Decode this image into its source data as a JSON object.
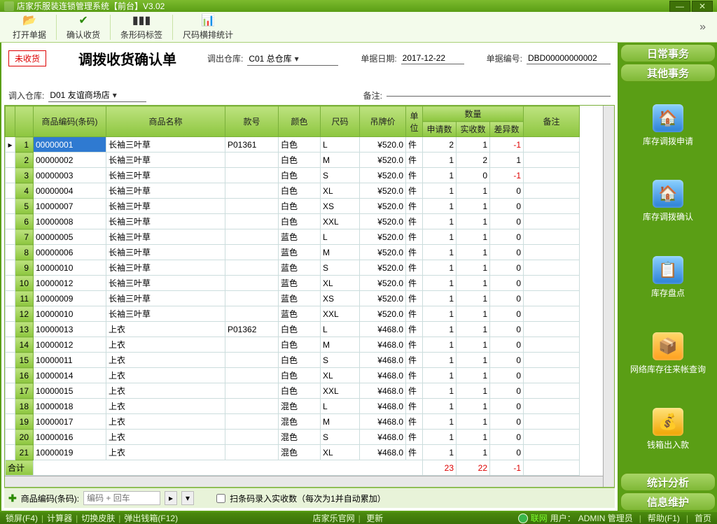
{
  "title": "店家乐服装连锁管理系统【前台】V3.02",
  "toolbar": {
    "open": "打开单据",
    "confirm": "确认收货",
    "barcode": "条形码标签",
    "sizerpt": "尺码横排统计"
  },
  "badge": "未收货",
  "form_title": "调拨收货确认单",
  "out_wh_lbl": "调出仓库:",
  "out_wh": "C01 总仓库",
  "date_lbl": "单据日期:",
  "date": "2017-12-22",
  "billno_lbl": "单据编号:",
  "billno": "DBD00000000002",
  "in_wh_lbl": "调入仓库:",
  "in_wh": "D01 友谊商场店",
  "remark_lbl": "备注:",
  "headers": {
    "code": "商品编码(条码)",
    "name": "商品名称",
    "style": "款号",
    "color": "颜色",
    "size": "尺码",
    "price": "吊牌价",
    "unit": "单位",
    "qty": "数量",
    "apply": "申请数",
    "recv": "实收数",
    "diff": "差异数",
    "remark": "备注"
  },
  "rows": [
    {
      "n": 1,
      "code": "00000001",
      "name": "长袖三叶草",
      "style": "P01361",
      "color": "白色",
      "size": "L",
      "price": "520.0",
      "unit": "件",
      "apply": 2,
      "recv": 1,
      "diff": -1
    },
    {
      "n": 2,
      "code": "00000002",
      "name": "长袖三叶草",
      "style": "",
      "color": "白色",
      "size": "M",
      "price": "520.0",
      "unit": "件",
      "apply": 1,
      "recv": 2,
      "diff": 1
    },
    {
      "n": 3,
      "code": "00000003",
      "name": "长袖三叶草",
      "style": "",
      "color": "白色",
      "size": "S",
      "price": "520.0",
      "unit": "件",
      "apply": 1,
      "recv": 0,
      "diff": -1
    },
    {
      "n": 4,
      "code": "00000004",
      "name": "长袖三叶草",
      "style": "",
      "color": "白色",
      "size": "XL",
      "price": "520.0",
      "unit": "件",
      "apply": 1,
      "recv": 1,
      "diff": 0
    },
    {
      "n": 5,
      "code": "10000007",
      "name": "长袖三叶草",
      "style": "",
      "color": "白色",
      "size": "XS",
      "price": "520.0",
      "unit": "件",
      "apply": 1,
      "recv": 1,
      "diff": 0
    },
    {
      "n": 6,
      "code": "10000008",
      "name": "长袖三叶草",
      "style": "",
      "color": "白色",
      "size": "XXL",
      "price": "520.0",
      "unit": "件",
      "apply": 1,
      "recv": 1,
      "diff": 0
    },
    {
      "n": 7,
      "code": "00000005",
      "name": "长袖三叶草",
      "style": "",
      "color": "蓝色",
      "size": "L",
      "price": "520.0",
      "unit": "件",
      "apply": 1,
      "recv": 1,
      "diff": 0
    },
    {
      "n": 8,
      "code": "00000006",
      "name": "长袖三叶草",
      "style": "",
      "color": "蓝色",
      "size": "M",
      "price": "520.0",
      "unit": "件",
      "apply": 1,
      "recv": 1,
      "diff": 0
    },
    {
      "n": 9,
      "code": "10000010",
      "name": "长袖三叶草",
      "style": "",
      "color": "蓝色",
      "size": "S",
      "price": "520.0",
      "unit": "件",
      "apply": 1,
      "recv": 1,
      "diff": 0
    },
    {
      "n": 10,
      "code": "10000012",
      "name": "长袖三叶草",
      "style": "",
      "color": "蓝色",
      "size": "XL",
      "price": "520.0",
      "unit": "件",
      "apply": 1,
      "recv": 1,
      "diff": 0
    },
    {
      "n": 11,
      "code": "10000009",
      "name": "长袖三叶草",
      "style": "",
      "color": "蓝色",
      "size": "XS",
      "price": "520.0",
      "unit": "件",
      "apply": 1,
      "recv": 1,
      "diff": 0
    },
    {
      "n": 12,
      "code": "10000010",
      "name": "长袖三叶草",
      "style": "",
      "color": "蓝色",
      "size": "XXL",
      "price": "520.0",
      "unit": "件",
      "apply": 1,
      "recv": 1,
      "diff": 0
    },
    {
      "n": 13,
      "code": "10000013",
      "name": "上衣",
      "style": "P01362",
      "color": "白色",
      "size": "L",
      "price": "468.0",
      "unit": "件",
      "apply": 1,
      "recv": 1,
      "diff": 0
    },
    {
      "n": 14,
      "code": "10000012",
      "name": "上衣",
      "style": "",
      "color": "白色",
      "size": "M",
      "price": "468.0",
      "unit": "件",
      "apply": 1,
      "recv": 1,
      "diff": 0
    },
    {
      "n": 15,
      "code": "10000011",
      "name": "上衣",
      "style": "",
      "color": "白色",
      "size": "S",
      "price": "468.0",
      "unit": "件",
      "apply": 1,
      "recv": 1,
      "diff": 0
    },
    {
      "n": 16,
      "code": "10000014",
      "name": "上衣",
      "style": "",
      "color": "白色",
      "size": "XL",
      "price": "468.0",
      "unit": "件",
      "apply": 1,
      "recv": 1,
      "diff": 0
    },
    {
      "n": 17,
      "code": "10000015",
      "name": "上衣",
      "style": "",
      "color": "白色",
      "size": "XXL",
      "price": "468.0",
      "unit": "件",
      "apply": 1,
      "recv": 1,
      "diff": 0
    },
    {
      "n": 18,
      "code": "10000018",
      "name": "上衣",
      "style": "",
      "color": "混色",
      "size": "L",
      "price": "468.0",
      "unit": "件",
      "apply": 1,
      "recv": 1,
      "diff": 0
    },
    {
      "n": 19,
      "code": "10000017",
      "name": "上衣",
      "style": "",
      "color": "混色",
      "size": "M",
      "price": "468.0",
      "unit": "件",
      "apply": 1,
      "recv": 1,
      "diff": 0
    },
    {
      "n": 20,
      "code": "10000016",
      "name": "上衣",
      "style": "",
      "color": "混色",
      "size": "S",
      "price": "468.0",
      "unit": "件",
      "apply": 1,
      "recv": 1,
      "diff": 0
    },
    {
      "n": 21,
      "code": "10000019",
      "name": "上衣",
      "style": "",
      "color": "混色",
      "size": "XL",
      "price": "468.0",
      "unit": "件",
      "apply": 1,
      "recv": 1,
      "diff": 0
    }
  ],
  "sum_lbl": "合计",
  "sum": {
    "apply": 23,
    "recv": 22,
    "diff": -1
  },
  "foot": {
    "label": "商品编码(条码):",
    "ph": "编码 + 回车",
    "scan": "扫条码录入实收数（每次为1并自动累加）"
  },
  "side": {
    "daily": "日常事务",
    "other": "其他事务",
    "i1": "库存调拨申请",
    "i2": "库存调拨确认",
    "i3": "库存盘点",
    "i4": "网络库存往来帐查询",
    "i5": "钱箱出入款",
    "stat": "统计分析",
    "info": "信息维护"
  },
  "status": {
    "lock": "锁屏(F4)",
    "calc": "计算器",
    "skin": "切换皮肤",
    "cash": "弹出钱箱(F12)",
    "site": "店家乐官网",
    "upd": "更新",
    "net": "联网",
    "user_lbl": "用户：",
    "user": "ADMIN 管理员",
    "help": "帮助(F1)",
    "home": "首页"
  }
}
